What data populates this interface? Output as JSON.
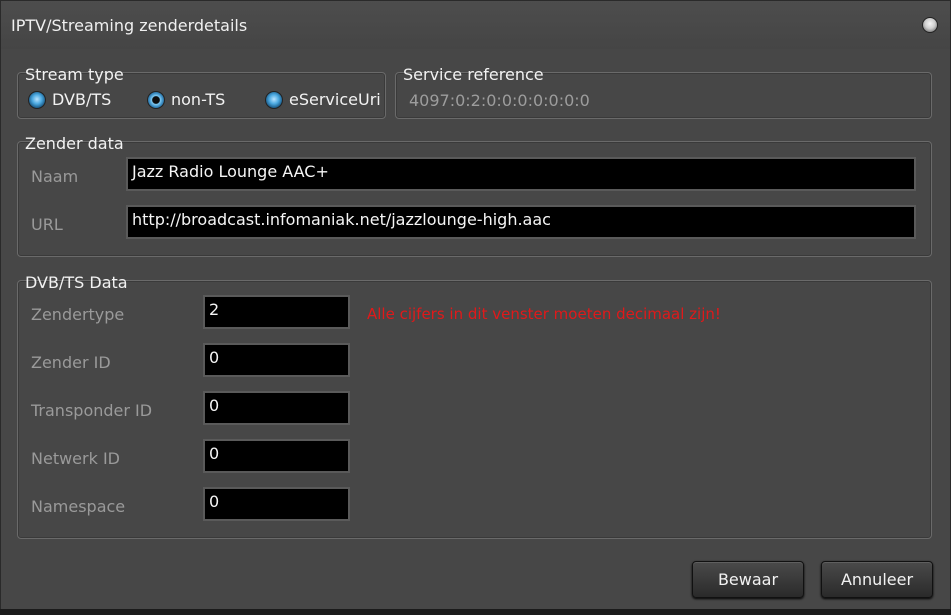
{
  "window": {
    "title": "IPTV/Streaming zenderdetails"
  },
  "stream_type": {
    "label": "Stream type",
    "options": [
      "DVB/TS",
      "non-TS",
      "eServiceUri"
    ],
    "selected": "non-TS"
  },
  "service_reference": {
    "label": "Service reference",
    "value": "4097:0:2:0:0:0:0:0:0:0"
  },
  "zender_data": {
    "label": "Zender data",
    "naam_label": "Naam",
    "naam_value": "Jazz Radio Lounge AAC+",
    "url_label": "URL",
    "url_value": "http://broadcast.infomaniak.net/jazzlounge-high.aac"
  },
  "dvb_data": {
    "label": "DVB/TS Data",
    "warning": "Alle cijfers in dit venster moeten decimaal zijn!",
    "fields": [
      {
        "label": "Zendertype",
        "value": "2"
      },
      {
        "label": "Zender ID",
        "value": "0"
      },
      {
        "label": "Transponder ID",
        "value": "0"
      },
      {
        "label": "Netwerk ID",
        "value": "0"
      },
      {
        "label": "Namespace",
        "value": "0"
      }
    ]
  },
  "buttons": {
    "save": "Bewaar",
    "cancel": "Annuleer"
  },
  "colors": {
    "warning": "#e0191a",
    "radio_accent": "#4aa8e0"
  }
}
